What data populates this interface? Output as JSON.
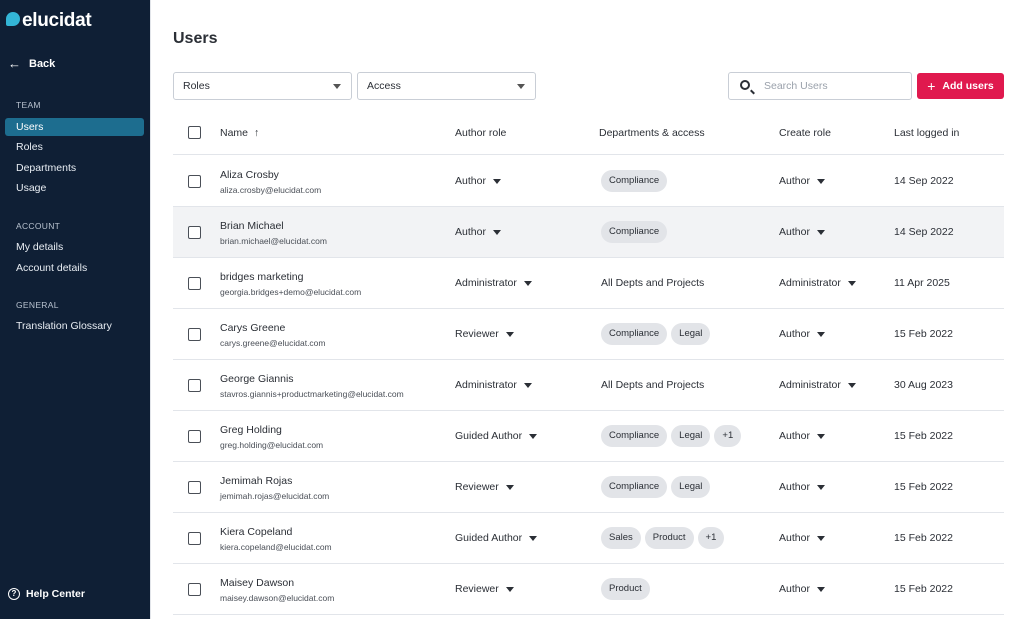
{
  "sidebar": {
    "logo": "elucidat",
    "back_label": "Back",
    "sections": [
      {
        "label": "TEAM",
        "items": [
          {
            "label": "Users",
            "active": true
          },
          {
            "label": "Roles"
          },
          {
            "label": "Departments"
          },
          {
            "label": "Usage"
          }
        ]
      },
      {
        "label": "ACCOUNT",
        "items": [
          {
            "label": "My details"
          },
          {
            "label": "Account details"
          }
        ]
      },
      {
        "label": "GENERAL",
        "items": [
          {
            "label": "Translation Glossary"
          }
        ]
      }
    ],
    "help_label": "Help Center"
  },
  "page": {
    "title": "Users",
    "filters": {
      "roles": "Roles",
      "access": "Access"
    },
    "search_placeholder": "Search Users",
    "add_button": "Add users",
    "accent_color": "#e0194e"
  },
  "table": {
    "columns": {
      "name": "Name",
      "author_role": "Author role",
      "departments": "Departments & access",
      "create_role": "Create role",
      "last_logged": "Last logged in"
    },
    "rows": [
      {
        "name": "Aliza Crosby",
        "email": "aliza.crosby@elucidat.com",
        "author_role": "Author",
        "depts": [
          "Compliance"
        ],
        "create_role": "Author",
        "last": "14 Sep 2022"
      },
      {
        "name": "Brian Michael",
        "email": "brian.michael@elucidat.com",
        "author_role": "Author",
        "depts": [
          "Compliance"
        ],
        "create_role": "Author",
        "last": "14 Sep 2022"
      },
      {
        "name": "bridges marketing",
        "email": "georgia.bridges+demo@elucidat.com",
        "author_role": "Administrator",
        "depts_text": "All Depts and Projects",
        "create_role": "Administrator",
        "last": "11 Apr 2025"
      },
      {
        "name": "Carys Greene",
        "email": "carys.greene@elucidat.com",
        "author_role": "Reviewer",
        "depts": [
          "Compliance",
          "Legal"
        ],
        "create_role": "Author",
        "last": "15 Feb 2022"
      },
      {
        "name": "George Giannis",
        "email": "stavros.giannis+productmarketing@elucidat.com",
        "author_role": "Administrator",
        "depts_text": "All Depts and Projects",
        "create_role": "Administrator",
        "last": "30 Aug 2023"
      },
      {
        "name": "Greg Holding",
        "email": "greg.holding@elucidat.com",
        "author_role": "Guided Author",
        "depts": [
          "Compliance",
          "Legal",
          "+1"
        ],
        "create_role": "Author",
        "last": "15 Feb 2022"
      },
      {
        "name": "Jemimah Rojas",
        "email": "jemimah.rojas@elucidat.com",
        "author_role": "Reviewer",
        "depts": [
          "Compliance",
          "Legal"
        ],
        "create_role": "Author",
        "last": "15 Feb 2022"
      },
      {
        "name": "Kiera Copeland",
        "email": "kiera.copeland@elucidat.com",
        "author_role": "Guided Author",
        "depts": [
          "Sales",
          "Product",
          "+1"
        ],
        "create_role": "Author",
        "last": "15 Feb 2022"
      },
      {
        "name": "Maisey Dawson",
        "email": "maisey.dawson@elucidat.com",
        "author_role": "Reviewer",
        "depts": [
          "Product"
        ],
        "create_role": "Author",
        "last": "15 Feb 2022"
      }
    ]
  }
}
